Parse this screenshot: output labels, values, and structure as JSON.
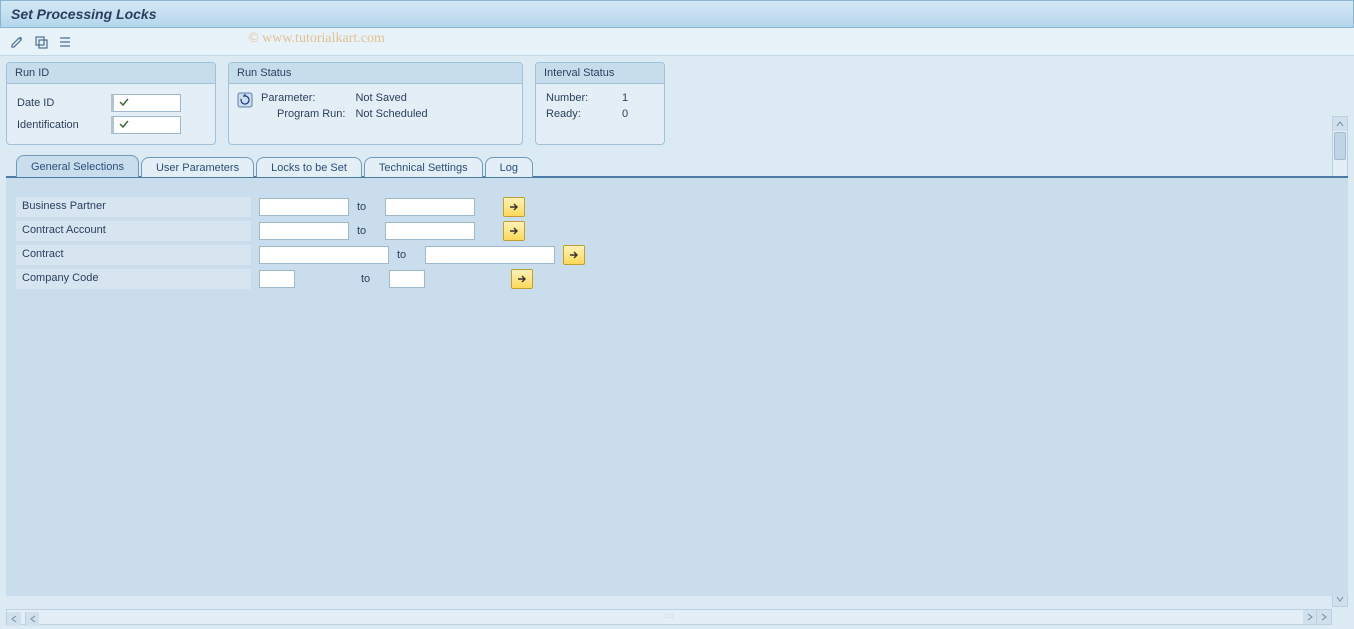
{
  "title": "Set Processing Locks",
  "watermark": "© www.tutorialkart.com",
  "groups": {
    "run_id": {
      "header": "Run ID",
      "date_id_label": "Date ID",
      "date_id_value": "",
      "identification_label": "Identification",
      "identification_value": ""
    },
    "run_status": {
      "header": "Run Status",
      "parameter_label": "Parameter:",
      "parameter_value": "Not Saved",
      "program_run_label": "Program Run:",
      "program_run_value": "Not Scheduled"
    },
    "interval_status": {
      "header": "Interval Status",
      "number_label": "Number:",
      "number_value": "1",
      "ready_label": "Ready:",
      "ready_value": "0"
    }
  },
  "tabs": {
    "general": "General Selections",
    "user_params": "User Parameters",
    "locks": "Locks to be Set",
    "tech": "Technical Settings",
    "log": "Log"
  },
  "selections": {
    "business_partner": {
      "label": "Business Partner",
      "from": "",
      "to_label": "to",
      "to": ""
    },
    "contract_account": {
      "label": "Contract Account",
      "from": "",
      "to_label": "to",
      "to": ""
    },
    "contract": {
      "label": "Contract",
      "from": "",
      "to_label": "to",
      "to": ""
    },
    "company_code": {
      "label": "Company Code",
      "from": "",
      "to_label": "to",
      "to": ""
    }
  }
}
